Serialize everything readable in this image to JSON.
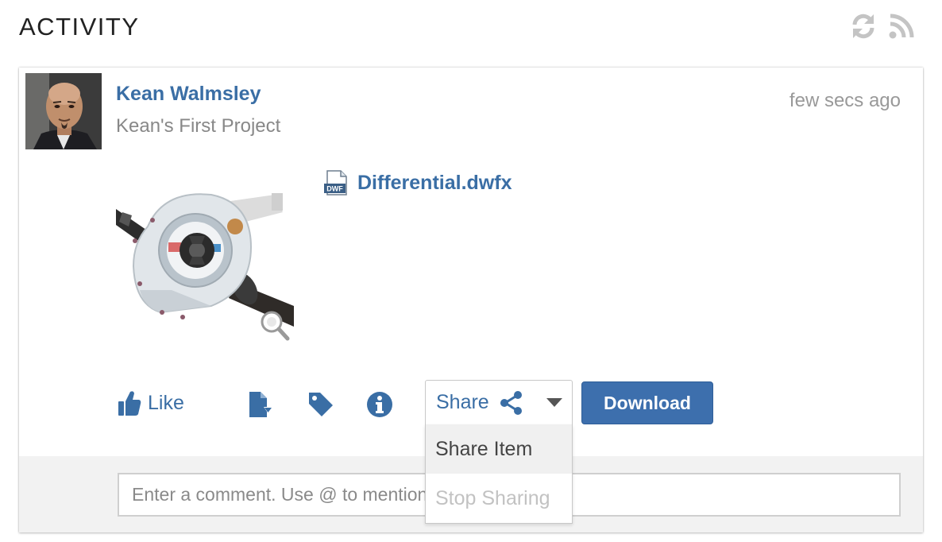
{
  "header": {
    "title": "ACTIVITY",
    "refresh_icon": "refresh-icon",
    "rss_icon": "rss-feed-icon"
  },
  "activity": {
    "author": "Kean Walmsley",
    "project": "Kean's First Project",
    "timestamp": "few secs ago",
    "file": {
      "icon": "dwf-file-icon",
      "icon_text": "DWF",
      "name": "Differential.dwfx"
    },
    "actions": {
      "like_label": "Like",
      "version_icon": "file-versions-icon",
      "tag_icon": "tag-icon",
      "info_icon": "info-icon",
      "share_label": "Share",
      "download_label": "Download"
    },
    "share_menu": {
      "items": [
        {
          "label": "Share Item",
          "enabled": true
        },
        {
          "label": "Stop Sharing",
          "enabled": false
        }
      ]
    },
    "comment": {
      "placeholder": "Enter a comment. Use @ to mention specific people."
    }
  },
  "colors": {
    "link": "#3a6ea5",
    "primary_button": "#3d6fad",
    "muted_text": "#888888",
    "comment_background": "#f2f2f2"
  }
}
